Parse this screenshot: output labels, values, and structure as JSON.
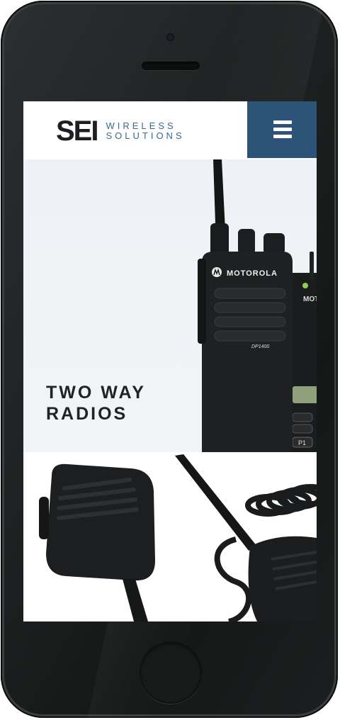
{
  "header": {
    "logo": {
      "mark": "SEI",
      "line1": "WIRELESS",
      "line2": "SOLUTIONS"
    },
    "menu_icon": "hamburger-menu-icon"
  },
  "hero": {
    "title": "TWO WAY\nRADIOS",
    "radio_brand": "MOTOROLA",
    "radio_model": "DP1400",
    "rear_radio_brand": "MOTOROLA",
    "rear_radio_key": "P1"
  },
  "colors": {
    "brand_blue": "#2e5378",
    "logo_text": "#1e1f22",
    "logo_sub": "#3b6a8f",
    "hero_bg": "#eef2f6"
  }
}
